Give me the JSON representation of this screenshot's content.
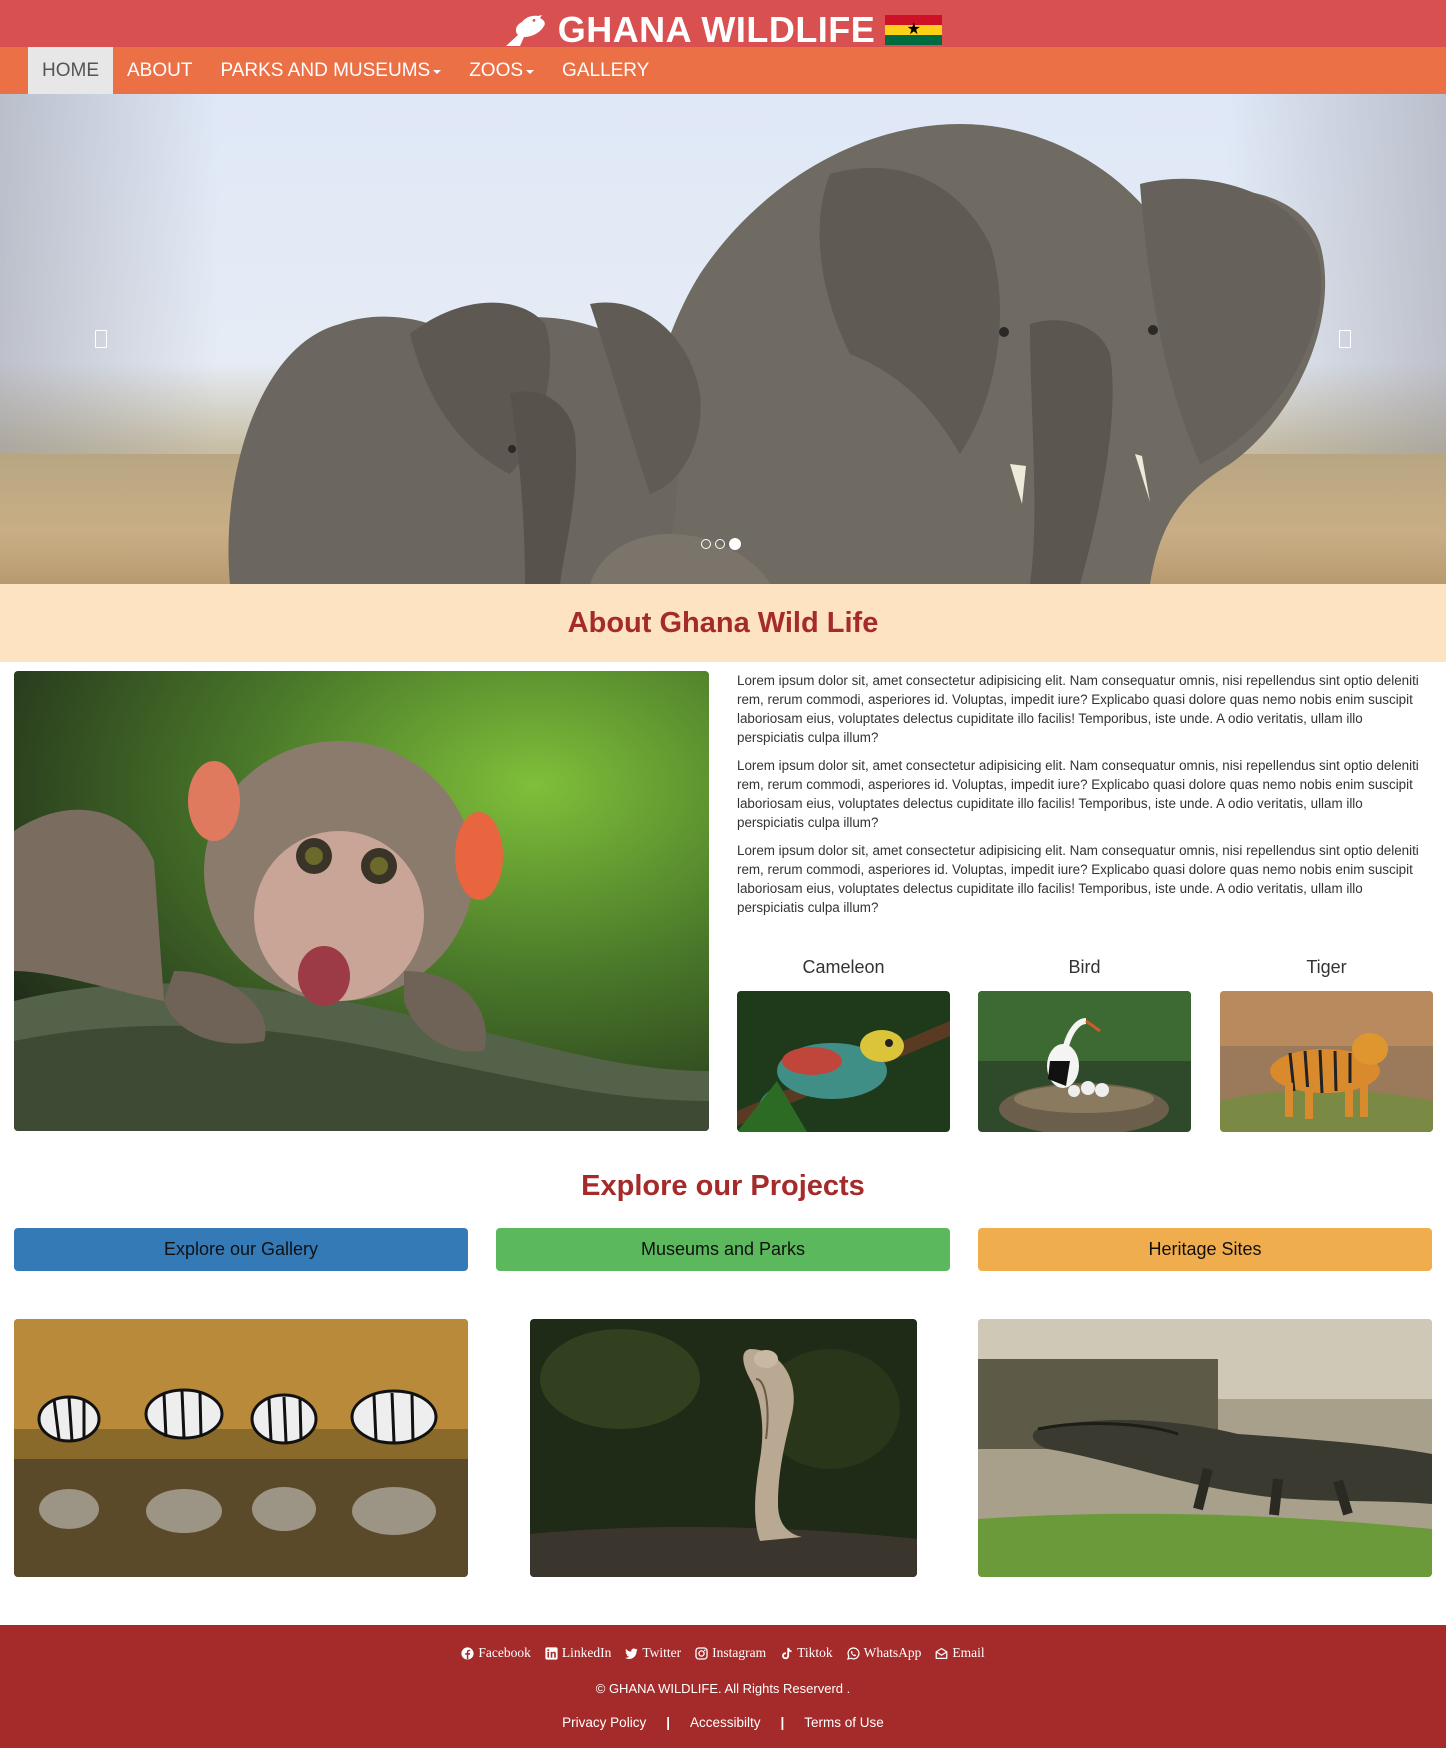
{
  "header": {
    "brand_text": "GHANA WILDLIFE",
    "bg_color": "#d95050",
    "nav_color": "#ec7046",
    "nav": [
      {
        "label": "HOME",
        "active": true
      },
      {
        "label": "ABOUT"
      },
      {
        "label": "PARKS AND MUSEUMS",
        "dropdown": true
      },
      {
        "label": "ZOOS",
        "dropdown": true
      },
      {
        "label": "GALLERY"
      }
    ]
  },
  "carousel": {
    "slide_count": 3,
    "active_slide": 3,
    "icons": {
      "prev": "chevron-left-icon",
      "next": "chevron-right-icon"
    }
  },
  "about": {
    "title": "About Ghana Wild Life",
    "paragraphs": [
      "Lorem ipsum dolor sit, amet consectetur adipisicing elit. Nam consequatur omnis, nisi repellendus sint optio deleniti rem, rerum commodi, asperiores id. Voluptas, impedit iure? Explicabo quasi dolore quas nemo nobis enim suscipit laboriosam eius, voluptates delectus cupiditate illo facilis! Temporibus, iste unde. A odio veritatis, ullam illo perspiciatis culpa illum?",
      "Lorem ipsum dolor sit, amet consectetur adipisicing elit. Nam consequatur omnis, nisi repellendus sint optio deleniti rem, rerum commodi, asperiores id. Voluptas, impedit iure? Explicabo quasi dolore quas nemo nobis enim suscipit laboriosam eius, voluptates delectus cupiditate illo facilis! Temporibus, iste unde. A odio veritatis, ullam illo perspiciatis culpa illum?",
      "Lorem ipsum dolor sit, amet consectetur adipisicing elit. Nam consequatur omnis, nisi repellendus sint optio deleniti rem, rerum commodi, asperiores id. Voluptas, impedit iure? Explicabo quasi dolore quas nemo nobis enim suscipit laboriosam eius, voluptates delectus cupiditate illo facilis! Temporibus, iste unde. A odio veritatis, ullam illo perspiciatis culpa illum?"
    ],
    "animals": [
      {
        "caption": "Cameleon"
      },
      {
        "caption": "Bird"
      },
      {
        "caption": "Tiger"
      }
    ]
  },
  "projects": {
    "title": "Explore our Projects",
    "buttons": [
      {
        "label": "Explore our Gallery",
        "color": "#337ab7"
      },
      {
        "label": "Museums and Parks",
        "color": "#5cb85c"
      },
      {
        "label": "Heritage Sites",
        "color": "#f0ad4e"
      }
    ]
  },
  "footer": {
    "bg_color": "#a52a2a",
    "social": [
      {
        "label": "Facebook",
        "icon": "facebook-icon"
      },
      {
        "label": "LinkedIn",
        "icon": "linkedin-icon"
      },
      {
        "label": "Twitter",
        "icon": "twitter-icon"
      },
      {
        "label": "Instagram",
        "icon": "instagram-icon"
      },
      {
        "label": "Tiktok",
        "icon": "tiktok-icon"
      },
      {
        "label": "WhatsApp",
        "icon": "whatsapp-icon"
      },
      {
        "label": "Email",
        "icon": "email-icon"
      }
    ],
    "copyright": "© GHANA WILDLIFE. All Rights Reserverd .",
    "legal": [
      {
        "label": "Privacy Policy"
      },
      {
        "label": "Accessibilty"
      },
      {
        "label": "Terms of Use"
      }
    ]
  }
}
